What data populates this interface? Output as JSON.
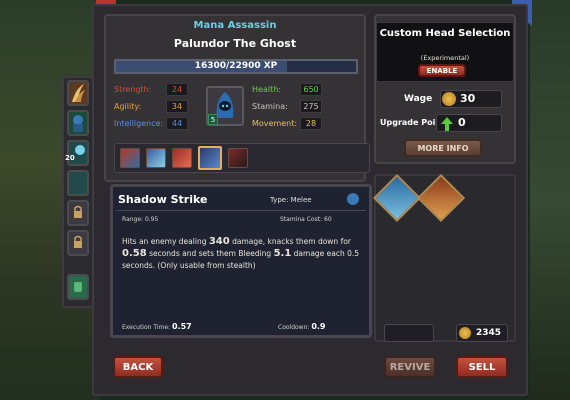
{
  "hero": {
    "class_name": "Mana Assassin",
    "name": "Palundor The Ghost",
    "xp": "16300/22900 XP",
    "xp_progress": 0.712
  },
  "stats": {
    "strength_label": "Strength:",
    "strength": "24",
    "agility_label": "Agility:",
    "agility": "34",
    "intelligence_label": "Intelligence:",
    "intelligence": "44",
    "health_label": "Health:",
    "health": "650",
    "stamina_label": "Stamina:",
    "stamina": "275",
    "movement_label": "Movement:",
    "movement": "28",
    "portrait_level": "5"
  },
  "side_slots": {
    "slot3_badge": "20"
  },
  "skill": {
    "name": "Shadow Strike",
    "type": "Type: Melee",
    "range": "Range: 0.95",
    "stamina_cost": "Stamina Cost: 60",
    "desc_1": "Hits an enemy dealing ",
    "damage": "340",
    "desc_2": " damage, knacks them down for ",
    "duration": "0.58",
    "desc_3": " seconds and sets them Bleeding ",
    "bleed": "5.1",
    "desc_4": " damage each 0.5 seconds. (Only usable from stealth)",
    "exec_label": "Execution Time: ",
    "exec_val": "0.57",
    "cooldown_label": "Cooldown: ",
    "cooldown_val": "0.9"
  },
  "custom_head": {
    "title": "Custom Head Selection",
    "subtitle": "(Experimental)",
    "enable": "ENABLE"
  },
  "wage": {
    "label": "Wage",
    "value": "30"
  },
  "upgrade": {
    "label": "Upgrade Points",
    "value": "0"
  },
  "more_info": "MORE INFO",
  "gold": "2345",
  "buttons": {
    "back": "BACK",
    "revive": "REVIVE",
    "sell": "SELL"
  },
  "colors": {
    "strength": "#e0483a",
    "agility": "#e8a040",
    "intelligence": "#5a8de0",
    "green": "#6ad04a",
    "title_blue": "#6ad0e8"
  }
}
